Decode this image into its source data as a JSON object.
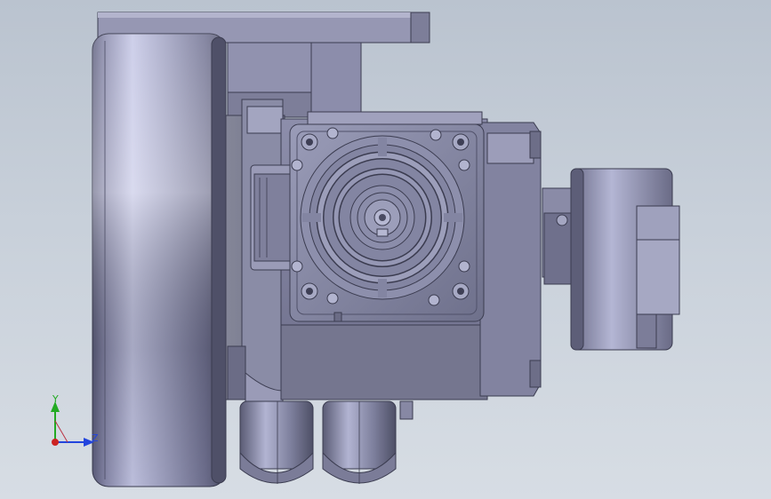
{
  "viewport": {
    "triad": {
      "y_label": "Y",
      "z_label": "Z",
      "y_color": "#22aa22",
      "z_color": "#2244dd",
      "x_color": "#cc2222"
    }
  }
}
